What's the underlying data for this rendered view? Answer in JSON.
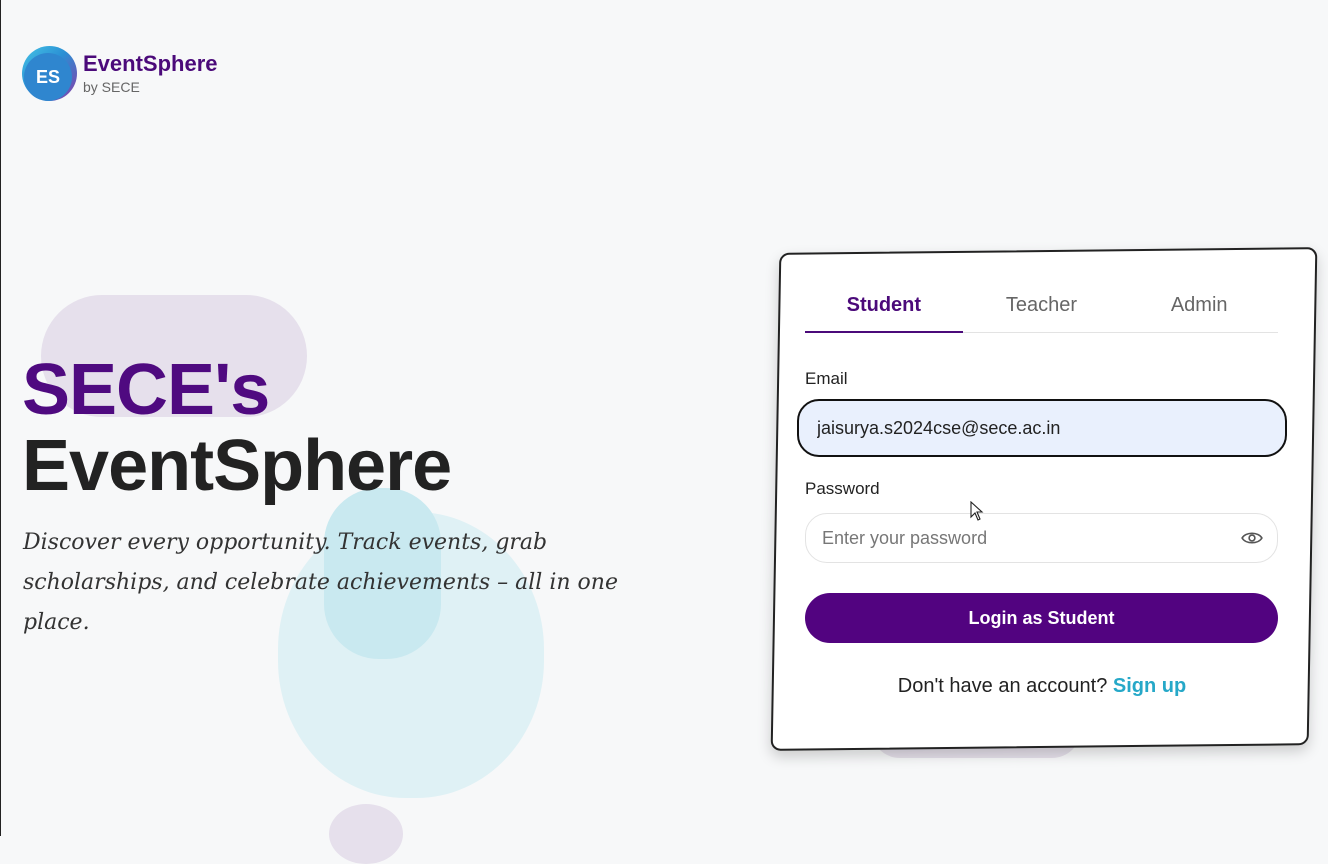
{
  "brand": {
    "badge": "ES",
    "title": "EventSphere",
    "subtitle": "by SECE"
  },
  "hero": {
    "line1": "SECE's",
    "line2": "EventSphere",
    "tagline": "Discover every opportunity. Track events, grab scholarships, and celebrate achievements – all in one place."
  },
  "login": {
    "tabs": [
      {
        "label": "Student",
        "active": true
      },
      {
        "label": "Teacher",
        "active": false
      },
      {
        "label": "Admin",
        "active": false
      }
    ],
    "email_label": "Email",
    "email_value": "jaisurya.s2024cse@sece.ac.in",
    "password_label": "Password",
    "password_placeholder": "Enter your password",
    "button_label": "Login as Student",
    "signup_prompt": "Don't have an account?",
    "signup_link": "Sign up"
  },
  "colors": {
    "brand_purple": "#520380",
    "link_teal": "#26a8c8",
    "email_bg": "#e9f0fd"
  },
  "icons": {
    "password_toggle": "eye-icon",
    "pointer": "mouse-cursor-icon"
  }
}
